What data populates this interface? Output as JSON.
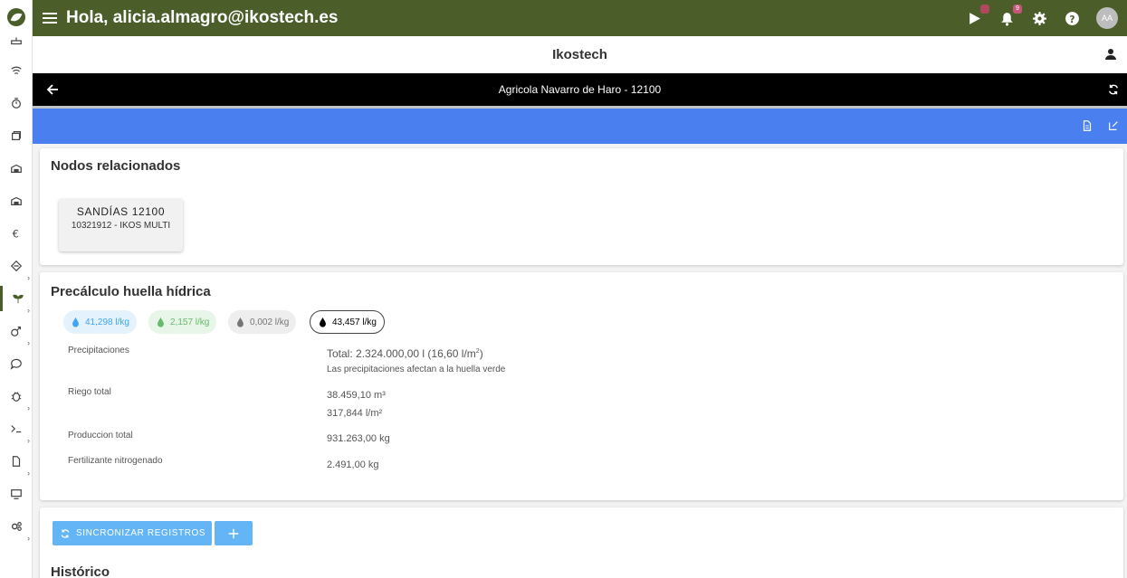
{
  "topbar": {
    "greeting": "Hola, alicia.almagro@ikostech.es",
    "notifications_count": "9",
    "avatar_initials": "AA",
    "bg_color": "#4b5e2a"
  },
  "company": {
    "name": "Ikostech"
  },
  "titlebar": {
    "title": "Agricola Navarro de Haro - 12100"
  },
  "nodos": {
    "heading": "Nodos relacionados",
    "items": [
      {
        "name": "SANDÍAS 12100",
        "sub": "10321912 - IKOS MULTI"
      }
    ]
  },
  "huella": {
    "heading": "Precálculo huella hídrica",
    "chips": [
      {
        "value": "41,298 l/kg",
        "color": "#42a5f5",
        "icon": "blue-drop-icon"
      },
      {
        "value": "2,157 l/kg",
        "color": "#66bb6a",
        "icon": "green-drop-icon"
      },
      {
        "value": "0,002 l/kg",
        "color": "#757575",
        "icon": "grey-drop-icon"
      },
      {
        "value": "43,457 l/kg",
        "color": "#000000",
        "icon": "black-drop-icon"
      }
    ],
    "precipitaciones": {
      "label": "Precipitaciones",
      "total_prefix": "Total: 2.324.000,00 l (16,60 l/m",
      "total_sup": "2",
      "total_suffix": ")",
      "note": "Las precipitaciones afectan a la huella verde"
    },
    "riego": {
      "label": "Riego total",
      "v1": "38.459,10 m³",
      "v2": "317,844 l/m²"
    },
    "produccion": {
      "label": "Produccion total",
      "value": "931.263,00 kg"
    },
    "fertilizante": {
      "label": "Fertilizante nitrogenado",
      "value": "2.491,00 kg"
    }
  },
  "registros": {
    "sync_label": "SINCRONIZAR REGISTROS",
    "historico_heading": "Histórico"
  }
}
